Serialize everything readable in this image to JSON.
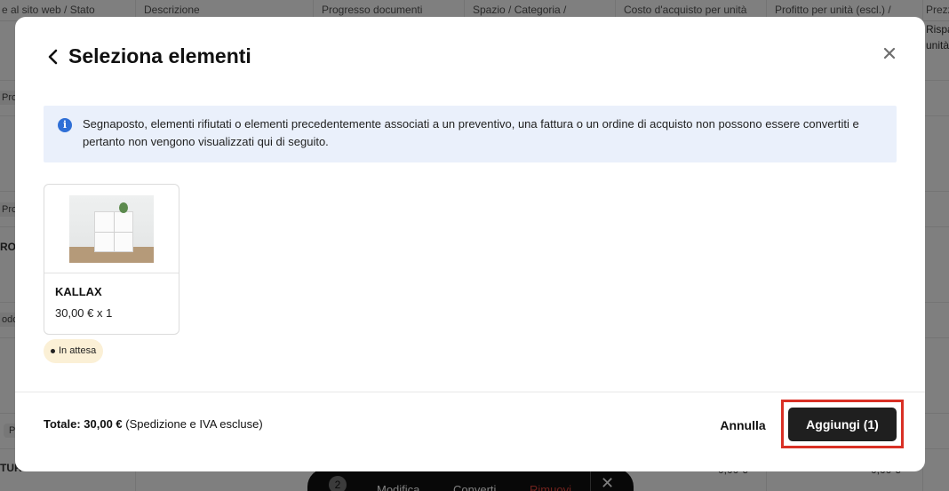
{
  "background": {
    "columns": [
      "e al sito web / Stato",
      "Descrizione",
      "Progresso documenti",
      "Spazio / Categoria /",
      "Costo d'acquisto per unità",
      "Profitto per unità (escl.) /",
      "Prezz"
    ],
    "side_labels": [
      "Proc",
      "Proc",
      "RO",
      "odo",
      "Pi",
      "TUR"
    ],
    "right_labels": [
      "Rispa",
      "unità"
    ],
    "bottom_values": [
      "0,00 €",
      "0,00 €"
    ]
  },
  "action_bar": {
    "count": "2",
    "modify_label": "Modifica",
    "convert_label": "Converti",
    "remove_label": "Rimuovi",
    "close_glyph": "✕"
  },
  "modal": {
    "title": "Seleziona elementi",
    "back_glyph": "‹",
    "close_glyph": "✕",
    "info": {
      "icon_glyph": "i",
      "text": "Segnaposto, elementi rifiutati o elementi precedentemente associati a un preventivo, una fattura o un ordine di acquisto non possono essere convertiti e pertanto non vengono visualizzati qui di seguito."
    },
    "items": [
      {
        "name": "KALLAX",
        "price": "30,00 € x 1",
        "status": "In attesa",
        "image_icon": "shelf-product-photo"
      }
    ],
    "footer": {
      "total_label": "Totale:",
      "total_value": "30,00 €",
      "total_note": "(Spedizione e IVA escluse)",
      "cancel_label": "Annulla",
      "add_label": "Aggiungi (1)"
    }
  },
  "colors": {
    "overlay": "rgba(0,0,0,0.5)",
    "info_bg": "#eaf0fb",
    "info_icon": "#2f6fd6",
    "status_bg": "#fbf0d6",
    "primary_button": "#1f1f1f",
    "highlight": "#d93025"
  }
}
